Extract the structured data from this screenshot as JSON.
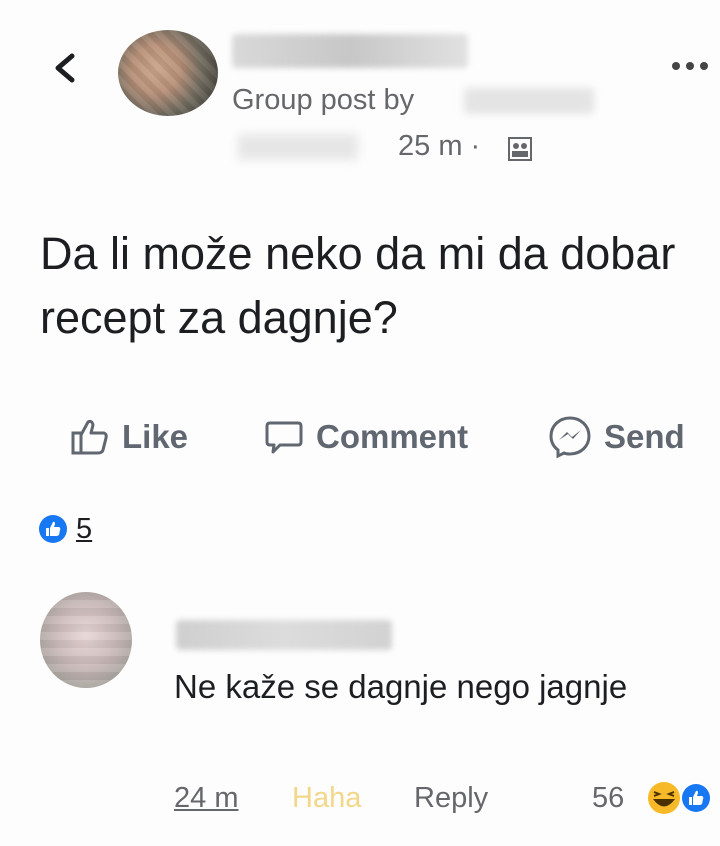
{
  "header": {
    "group_post_by": "Group post by",
    "time": "25 m ·"
  },
  "post": {
    "text": "Da li može neko da mi da dobar recept za dagnje?"
  },
  "actions": {
    "like": "Like",
    "comment": "Comment",
    "send": "Send"
  },
  "reactions": {
    "count": "5"
  },
  "comment": {
    "text": "Ne kaže se dagnje nego jagnje",
    "time": "24 m",
    "haha": "Haha",
    "reply": "Reply",
    "reaction_count": "56"
  },
  "colors": {
    "like_blue": "#1877f2",
    "haha_yellow": "#f7b928",
    "muted_text": "#65676b"
  }
}
